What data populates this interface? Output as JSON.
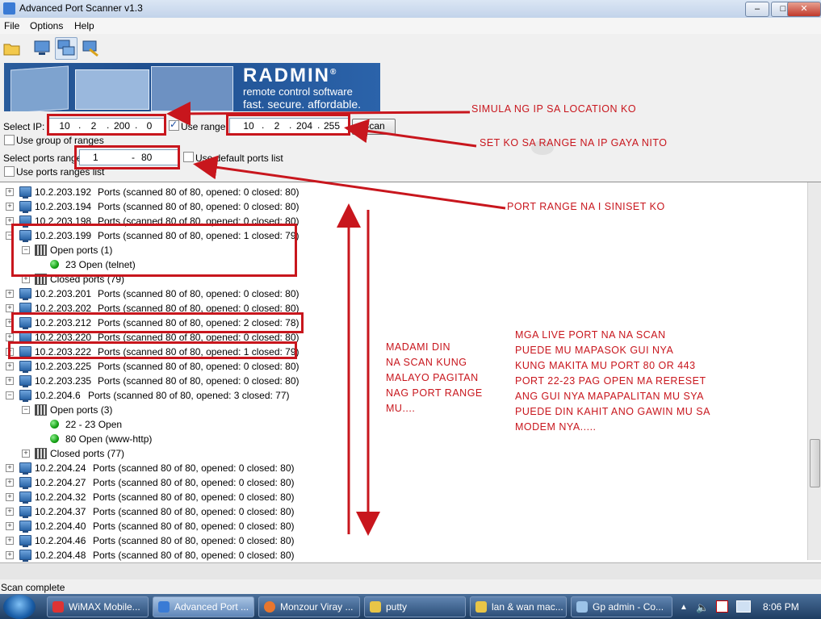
{
  "window": {
    "title": "Advanced Port Scanner v1.3",
    "min": "0",
    "max": "1",
    "close": "r"
  },
  "menu": [
    "File",
    "Options",
    "Help"
  ],
  "banner": {
    "brand": "RADMIN",
    "reg": "®",
    "tagline1": "remote control software",
    "tagline2": "fast. secure. affordable."
  },
  "form": {
    "select_ip_label": "Select IP:",
    "ip_from": [
      "10",
      "2",
      "200",
      "0"
    ],
    "use_range_label": "Use range",
    "use_range_checked": true,
    "ip_to": [
      "10",
      "2",
      "204",
      "255"
    ],
    "scan_label": "Scan",
    "use_group_label": "Use group of ranges",
    "select_ports_label": "Select ports range",
    "port_from": "1",
    "port_to": "80",
    "port_sep": "-",
    "use_default_ports_label": "Use default ports list",
    "use_ports_list_label": "Use ports ranges list"
  },
  "tree": [
    {
      "type": "host",
      "ip": "10.2.203.192",
      "ports": "Ports (scanned 80 of 80, opened: 0 closed: 80)",
      "exp": "+"
    },
    {
      "type": "host",
      "ip": "10.2.203.194",
      "ports": "Ports (scanned 80 of 80, opened: 0 closed: 80)",
      "exp": "+"
    },
    {
      "type": "host",
      "ip": "10.2.203.198",
      "ports": "Ports (scanned 80 of 80, opened: 0 closed: 80)",
      "exp": "+"
    },
    {
      "type": "host",
      "ip": "10.2.203.199",
      "ports": "Ports (scanned 80 of 80, opened: 1 closed: 79)",
      "exp": "−"
    },
    {
      "type": "group",
      "label": "Open ports (1)",
      "exp": "−"
    },
    {
      "type": "port",
      "label": "23 Open (telnet)"
    },
    {
      "type": "group",
      "label": "Closed ports (79)",
      "exp": "+"
    },
    {
      "type": "host",
      "ip": "10.2.203.201",
      "ports": "Ports (scanned 80 of 80, opened: 0 closed: 80)",
      "exp": "+"
    },
    {
      "type": "host",
      "ip": "10.2.203.202",
      "ports": "Ports (scanned 80 of 80, opened: 0 closed: 80)",
      "exp": "+"
    },
    {
      "type": "host",
      "ip": "10.2.203.212",
      "ports": "Ports (scanned 80 of 80, opened: 2 closed: 78)",
      "exp": "+"
    },
    {
      "type": "host",
      "ip": "10.2.203.220",
      "ports": "Ports (scanned 80 of 80, opened: 0 closed: 80)",
      "exp": "+"
    },
    {
      "type": "host",
      "ip": "10.2.203.222",
      "ports": "Ports (scanned 80 of 80, opened: 1 closed: 79)",
      "exp": "+"
    },
    {
      "type": "host",
      "ip": "10.2.203.225",
      "ports": "Ports (scanned 80 of 80, opened: 0 closed: 80)",
      "exp": "+"
    },
    {
      "type": "host",
      "ip": "10.2.203.235",
      "ports": "Ports (scanned 80 of 80, opened: 0 closed: 80)",
      "exp": "+"
    },
    {
      "type": "host",
      "ip": "10.2.204.6",
      "ports": "Ports (scanned 80 of 80, opened: 3 closed: 77)",
      "exp": "−"
    },
    {
      "type": "group",
      "label": "Open ports (3)",
      "exp": "−"
    },
    {
      "type": "port",
      "label": "22 - 23 Open"
    },
    {
      "type": "port",
      "label": "80 Open (www-http)"
    },
    {
      "type": "group",
      "label": "Closed ports (77)",
      "exp": "+"
    },
    {
      "type": "host",
      "ip": "10.2.204.24",
      "ports": "Ports (scanned 80 of 80, opened: 0 closed: 80)",
      "exp": "+"
    },
    {
      "type": "host",
      "ip": "10.2.204.27",
      "ports": "Ports (scanned 80 of 80, opened: 0 closed: 80)",
      "exp": "+"
    },
    {
      "type": "host",
      "ip": "10.2.204.32",
      "ports": "Ports (scanned 80 of 80, opened: 0 closed: 80)",
      "exp": "+"
    },
    {
      "type": "host",
      "ip": "10.2.204.37",
      "ports": "Ports (scanned 80 of 80, opened: 0 closed: 80)",
      "exp": "+"
    },
    {
      "type": "host",
      "ip": "10.2.204.40",
      "ports": "Ports (scanned 80 of 80, opened: 0 closed: 80)",
      "exp": "+"
    },
    {
      "type": "host",
      "ip": "10.2.204.46",
      "ports": "Ports (scanned 80 of 80, opened: 0 closed: 80)",
      "exp": "+"
    },
    {
      "type": "host",
      "ip": "10.2.204.48",
      "ports": "Ports (scanned 80 of 80, opened: 0 closed: 80)",
      "exp": "+"
    }
  ],
  "annotations": {
    "note1": "SIMULA NG IP SA LOCATION KO",
    "note2": "SET KO SA RANGE NA IP GAYA NITO",
    "note3": "PORT RANGE NA I SINISET KO",
    "note4": "MADAMI DIN\nNA SCAN KUNG\nMALAYO PAGITAN\nNAG PORT RANGE\nMU....",
    "note5": "MGA LIVE PORT NA NA SCAN\nPUEDE MU MAPASOK GUI NYA\nKUNG MAKITA MU PORT 80 OR 443\nPORT 22-23 PAG OPEN MA RERESET\nANG GUI NYA MAPAPALITAN MU SYA\nPUEDE DIN KAHIT ANO GAWIN MU SA\nMODEM NYA.....",
    "color": "#c8161d"
  },
  "status": "Scan complete",
  "taskbar": {
    "tasks": [
      "WiMAX Mobile...",
      "Advanced Port ...",
      "Monzour Viray ...",
      "putty",
      "lan & wan mac...",
      "Gp admin - Co..."
    ],
    "clock": "8:06 PM"
  },
  "icons": [
    "open-folder-icon",
    "computer-icon",
    "network-computers-icon",
    "remote-tools-icon",
    "pc-icon",
    "port-icon",
    "green-status-icon"
  ]
}
